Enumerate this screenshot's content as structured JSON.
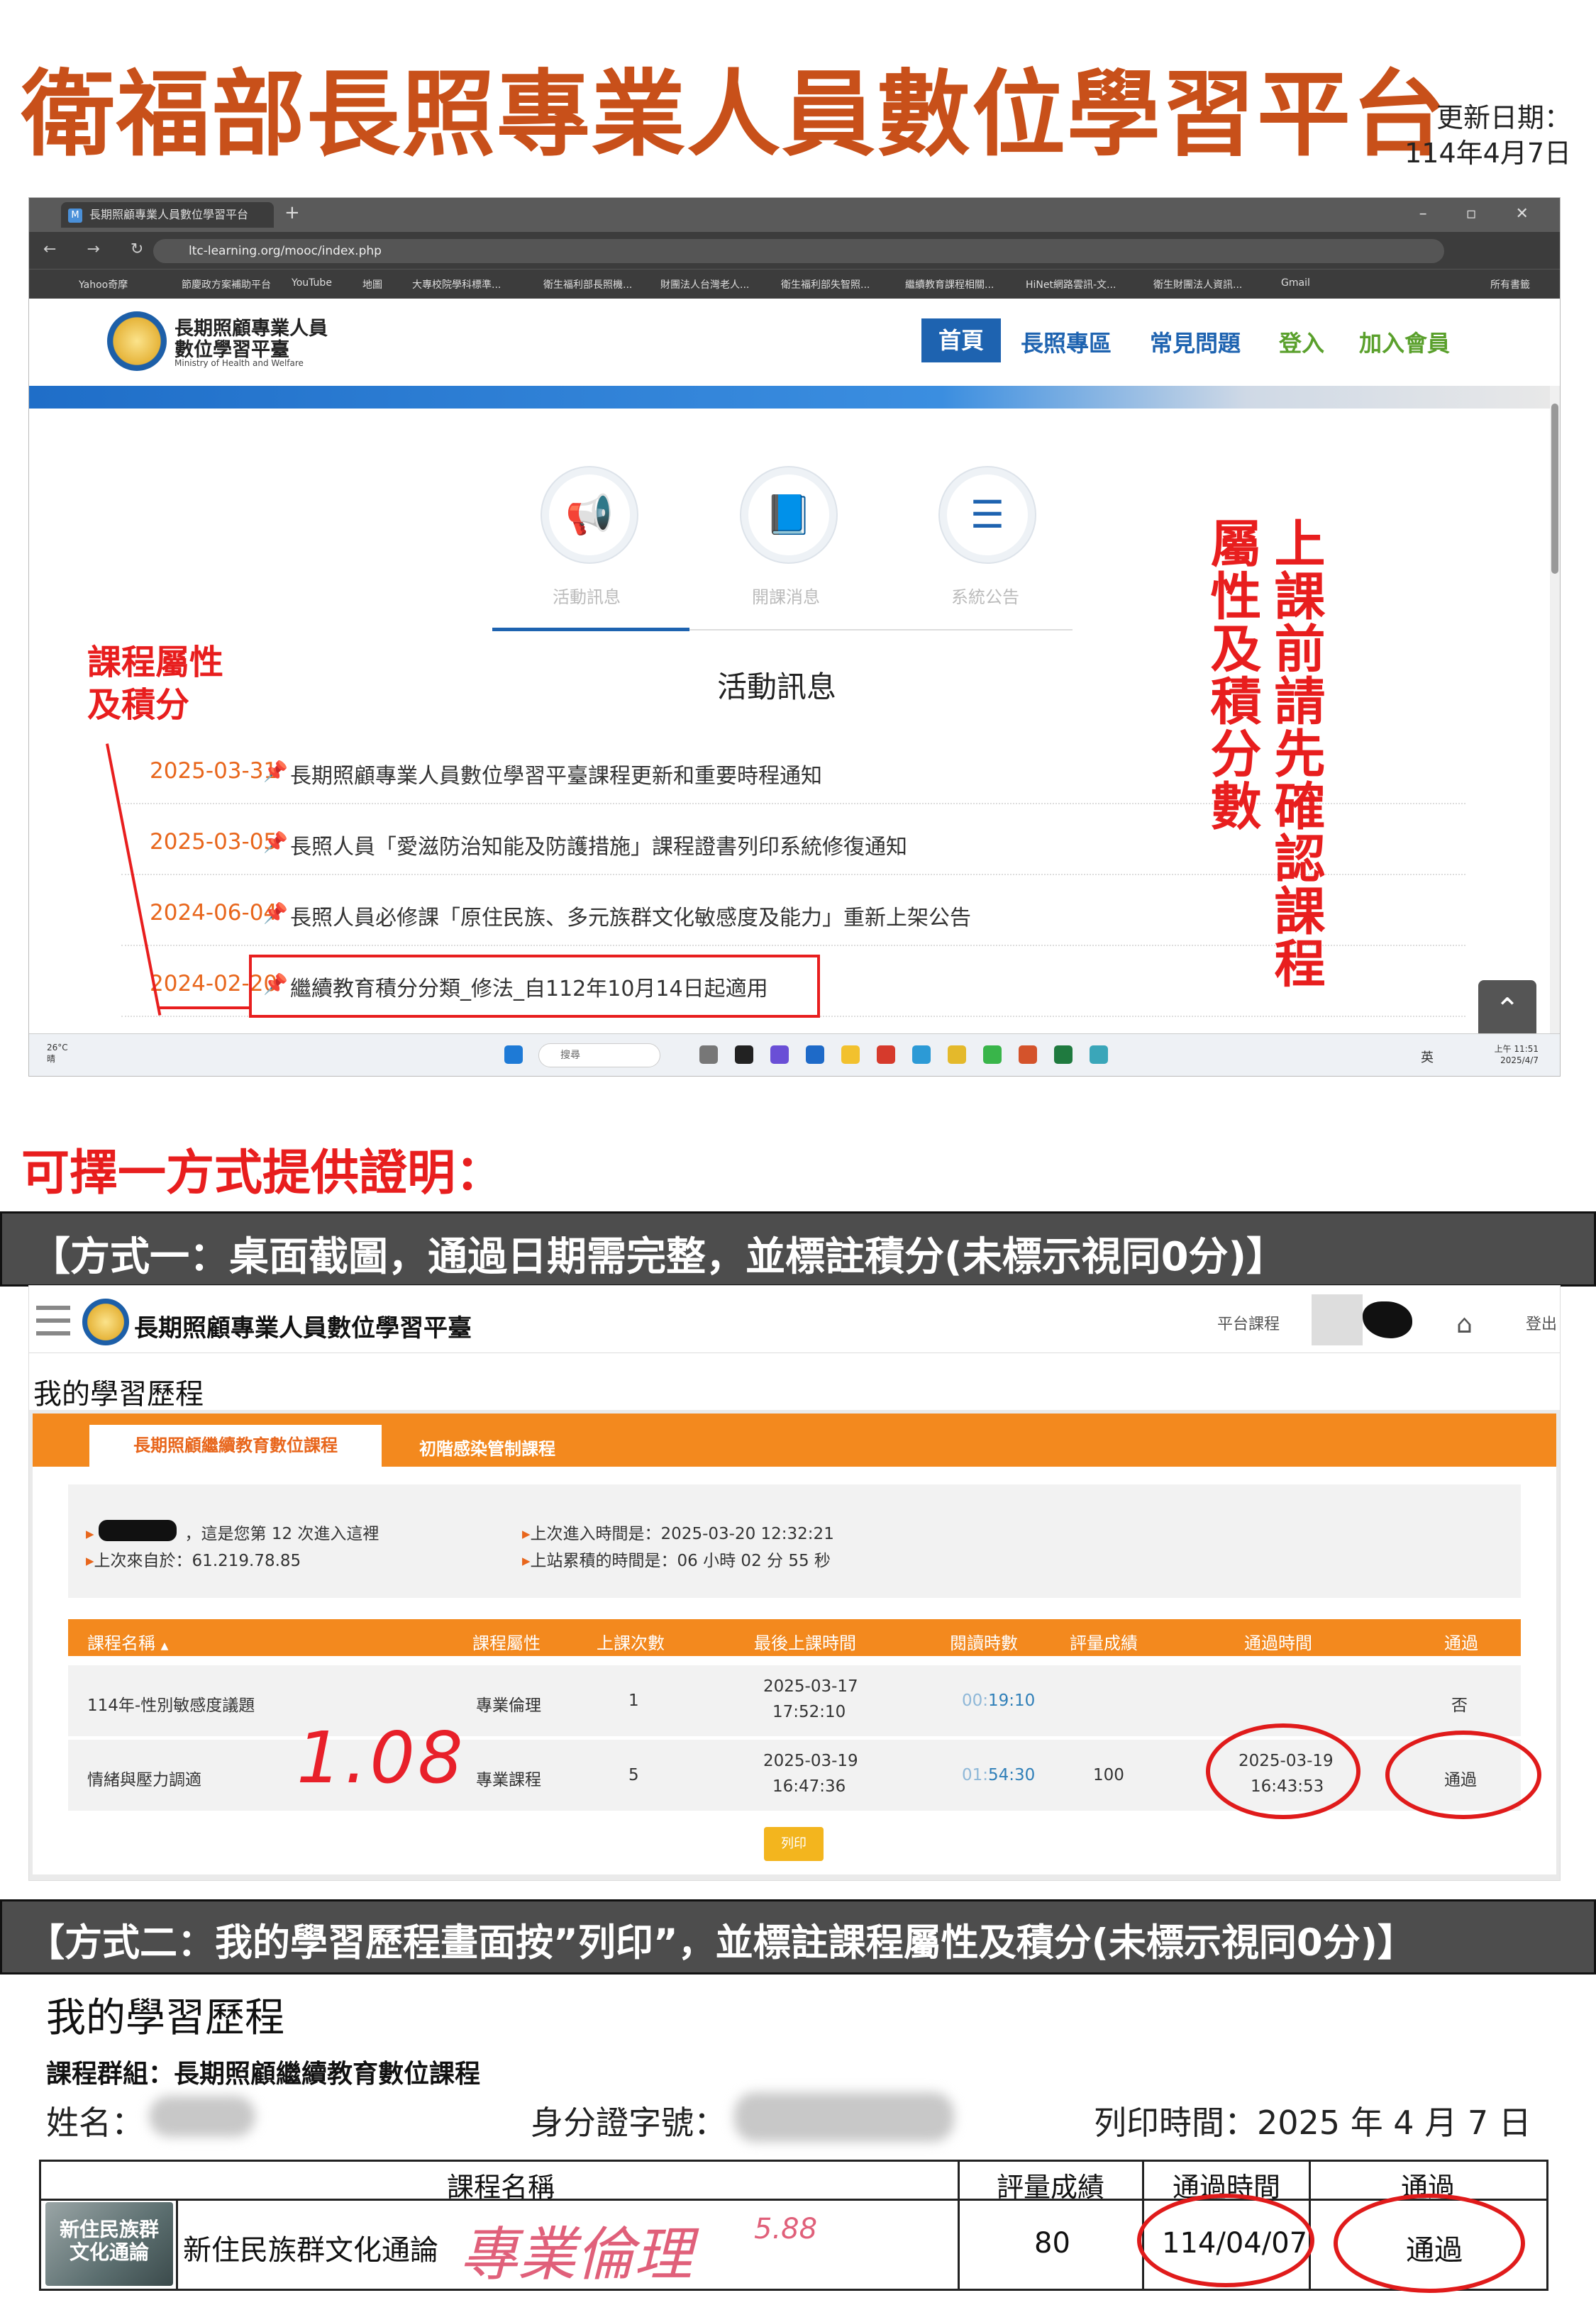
{
  "header": {
    "title": "衛福部長照專業人員數位學習平台",
    "update_label": "更新日期：",
    "update_value": "114年4月7日"
  },
  "shot1": {
    "browser": {
      "tab_title": "長期照顧專業人員數位學習平台",
      "url": "ltc-learning.org/mooc/index.php",
      "bookmarks": [
        "Yahoo奇摩",
        "節慶政方案補助平台",
        "YouTube",
        "地圖",
        "大專校院學科標準...",
        "衛生福利部長照機...",
        "財團法人台灣老人...",
        "衛生福利部失智照...",
        "繼續教育課程相關...",
        "HiNet網路雲訊-文...",
        "衛生財團法人資訊...",
        "Gmail",
        "所有書籤"
      ]
    },
    "site": {
      "logo_line1": "長期照顧專業人員",
      "logo_line2": "數位學習平臺",
      "logo_line3": "Ministry of Health and Welfare",
      "nav": [
        "首頁",
        "長照專區",
        "常見問題",
        "登入",
        "加入會員"
      ]
    },
    "tabs": [
      "活動訊息",
      "開課消息",
      "系統公告"
    ],
    "section_title": "活動訊息",
    "news": [
      {
        "date": "2025-03-31",
        "title": "長期照顧專業人員數位學習平臺課程更新和重要時程通知"
      },
      {
        "date": "2025-03-05",
        "title": "長照人員「愛滋防治知能及防護措施」課程證書列印系統修復通知"
      },
      {
        "date": "2024-06-04",
        "title": "長照人員必修課「原住民族、多元族群文化敏感度及能力」重新上架公告"
      },
      {
        "date": "2024-02-20",
        "title": "繼續教育積分分類_修法_自112年10月14日起適用"
      }
    ],
    "annotation_left_line1": "課程屬性",
    "annotation_left_line2": "及積分",
    "annotation_right_col1": "上課前請先確認課程",
    "annotation_right_col2": "屬性及積分數",
    "taskbar": {
      "weather_temp": "26°C",
      "weather_desc": "晴",
      "search": "搜尋",
      "tray": "英",
      "time": "上午 11:51",
      "date": "2025/4/7"
    }
  },
  "choose_title": "可擇一方式提供證明：",
  "method1": "【方式一：桌面截圖，通過日期需完整，並標註積分(未標示視同0分)】",
  "method2": "【方式二：我的學習歷程畫面按”列印”，並標註課程屬性及積分(未標示視同0分)】",
  "shot2": {
    "logo_text": "長期照顧專業人員數位學習平臺",
    "platform_link": "平台課程",
    "logout": "登出",
    "page_title": "我的學習歷程",
    "tab_active": "長期照顧繼續教育數位課程",
    "tab_other": "初階感染管制課程",
    "info": {
      "visits": "，這是您第 12 次進入這裡",
      "from": "上次來自於：61.219.78.85",
      "last_enter": "上次進入時間是：2025-03-20 12:32:21",
      "total_time": "上站累積的時間是：06 小時 02 分 55 秒"
    },
    "headers": [
      "課程名稱",
      "課程屬性",
      "上課次數",
      "最後上課時間",
      "閱讀時數",
      "評量成績",
      "通過時間",
      "通過"
    ],
    "sort_mark": "▲",
    "rows": [
      {
        "name": "114年-性別敏感度議題",
        "attr": "專業倫理",
        "count": "1",
        "last_date": "2025-03-17",
        "last_time": "17:52:10",
        "read_dim": "00:",
        "read": "19:10",
        "score": "",
        "pass_date": "",
        "pass_time": "",
        "pass": "否"
      },
      {
        "name": "情緒與壓力調適",
        "attr": "專業課程",
        "count": "5",
        "last_date": "2025-03-19",
        "last_time": "16:47:36",
        "read_dim": "01:",
        "read": "54:30",
        "score": "100",
        "pass_date": "2025-03-19",
        "pass_time": "16:43:53",
        "pass": "通過"
      }
    ],
    "print_button": "列印",
    "handwritten_credit": "1.08"
  },
  "shot3": {
    "title": "我的學習歷程",
    "group": "課程群組：長期照顧繼續教育數位課程",
    "name_label": "姓名：",
    "id_label": "身分證字號：",
    "print_time": "列印時間：2025 年  4 月  7 日",
    "headers": [
      "課程名稱",
      "評量成績",
      "通過時間",
      "通過"
    ],
    "cover_text_line1": "新住民族群",
    "cover_text_line2": "文化通論",
    "course_name": "新住民族群文化通論",
    "handwritten_attr": "專業倫理",
    "handwritten_credit": "5.88",
    "score": "80",
    "pass_time": "114/04/07",
    "pass": "通過"
  },
  "colors": {
    "title_orange": "#c8501a",
    "annotation_red": "#e81e1e",
    "platform_orange": "#f3891e",
    "nav_blue": "#1e63b0"
  }
}
